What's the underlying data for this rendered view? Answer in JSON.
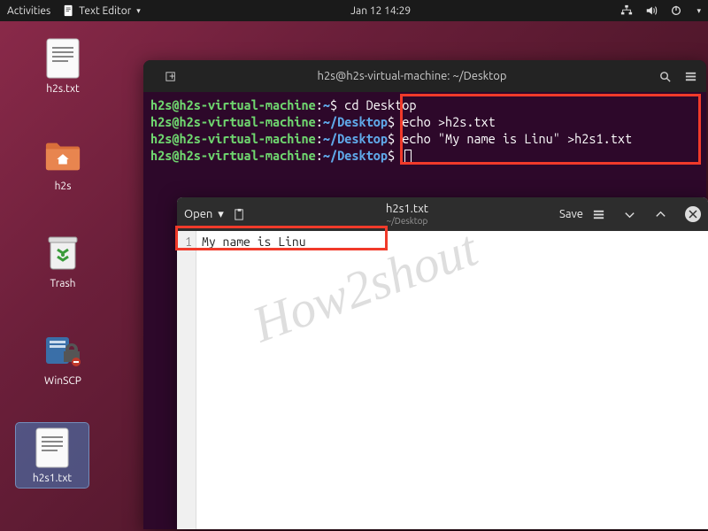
{
  "topbar": {
    "activities": "Activities",
    "app_name": "Text Editor",
    "datetime": "Jan 12  14:29"
  },
  "desktop": {
    "icons": [
      {
        "label": "h2s.txt"
      },
      {
        "label": "h2s"
      },
      {
        "label": "Trash"
      },
      {
        "label": "WinSCP"
      },
      {
        "label": "h2s1.txt"
      }
    ]
  },
  "terminal": {
    "title": "h2s@h2s-virtual-machine: ~/Desktop",
    "user_host": "h2s@h2s-virtual-machine",
    "lines": [
      {
        "path": "~",
        "cmd": "cd Desktop"
      },
      {
        "path": "~/Desktop",
        "cmd": "echo >h2s.txt"
      },
      {
        "path": "~/Desktop",
        "cmd": "echo \"My name is Linu\" >h2s1.txt"
      },
      {
        "path": "~/Desktop",
        "cmd": ""
      }
    ]
  },
  "gedit": {
    "open_label": "Open",
    "title": "h2s1.txt",
    "subtitle": "~/Desktop",
    "save_label": "Save",
    "line_number": "1",
    "content": "My name is Linu"
  },
  "watermark": "How2shout"
}
